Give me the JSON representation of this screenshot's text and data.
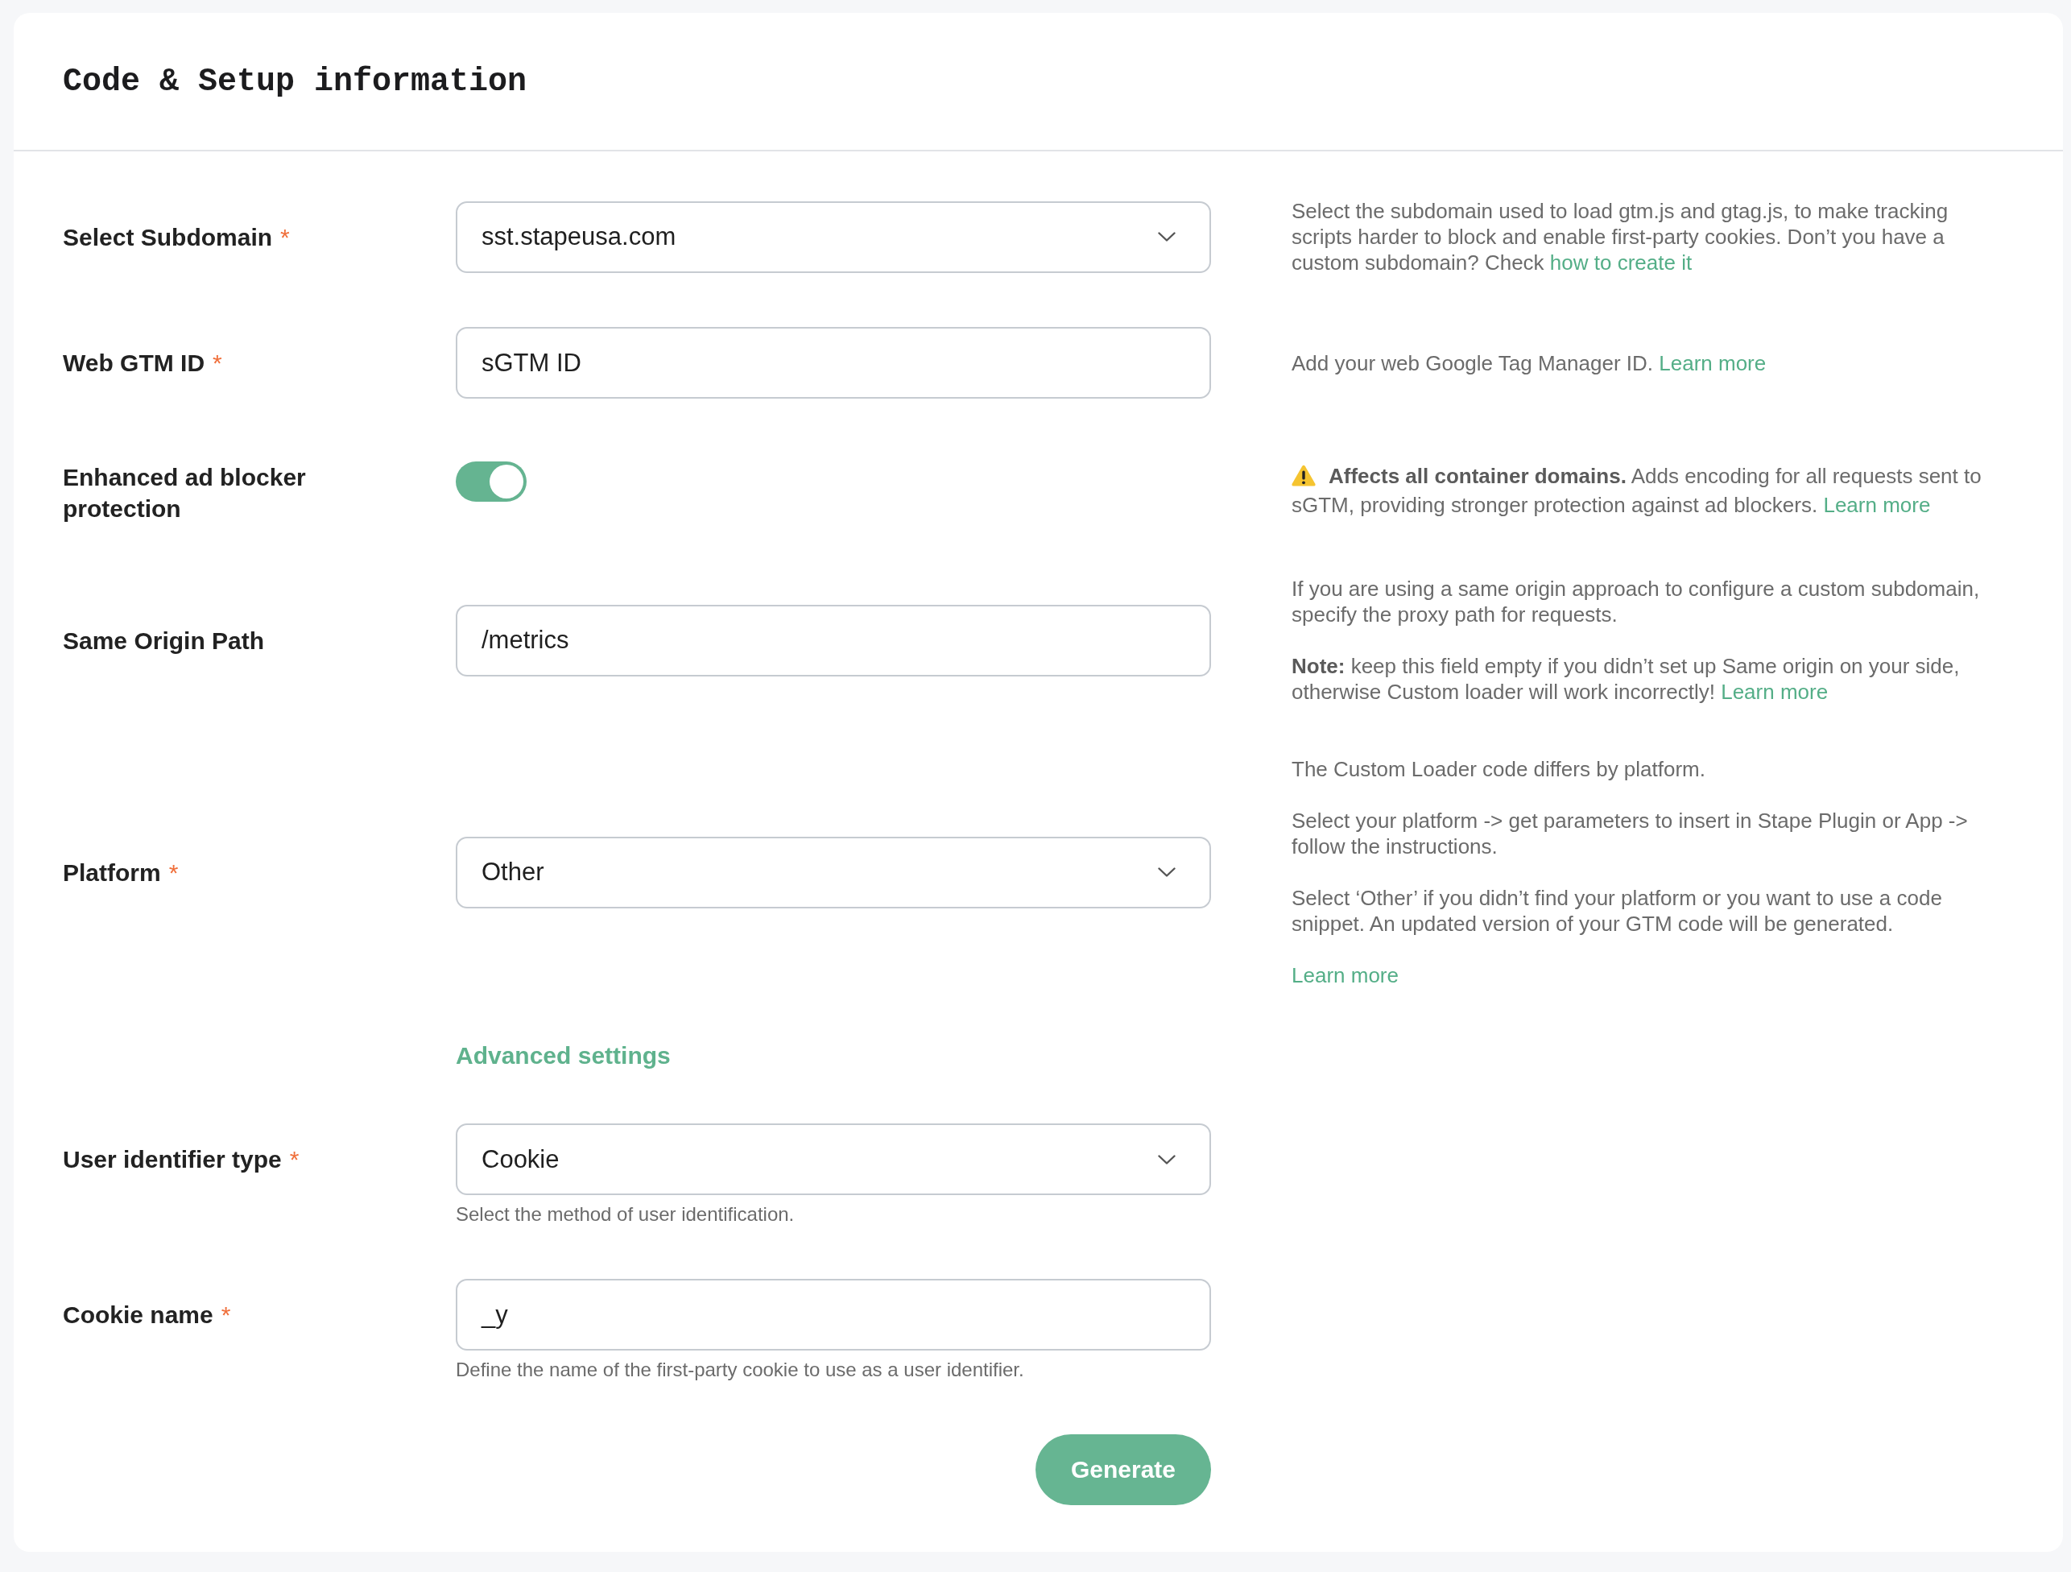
{
  "panel": {
    "title": "Code & Setup information"
  },
  "fields": [
    {
      "kind": "select",
      "label": "Select Subdomain",
      "required_marker": "*",
      "value": "sst.stapeusa.com",
      "help": [
        {
          "kind": "plain",
          "text": "Select the subdomain used to load gtm.js and gtag.js, to make tracking scripts harder to block and enable first-party cookies. Don’t you have a custom subdomain? Check",
          "link": "how to create it"
        }
      ]
    },
    {
      "kind": "text",
      "label": "Web GTM ID",
      "required_marker": "*",
      "value": "sGTM ID",
      "help": [
        {
          "kind": "plain",
          "text": "Add your web Google Tag Manager ID.",
          "link": "Learn more"
        }
      ]
    },
    {
      "kind": "toggle",
      "label": "Enhanced ad blocker protection",
      "on": true,
      "help": [
        {
          "kind": "warning",
          "text": "**Affects all container domains.** Adds encoding for all requests sent to sGTM, providing stronger protection against ad blockers.",
          "link": "Learn more"
        }
      ]
    },
    {
      "kind": "text",
      "label": "Same Origin Path",
      "value": "/metrics",
      "help": [
        {
          "kind": "plain",
          "text": "If you are using a same origin approach to configure a custom subdomain, specify the proxy path for requests."
        },
        {
          "kind": "plain",
          "text": "**Note:** keep this field empty if you didn’t set up Same origin on your side, otherwise Custom loader will work incorrectly!",
          "link": "Learn more"
        }
      ]
    },
    {
      "kind": "select",
      "label": "Platform",
      "required_marker": "*",
      "value": "Other",
      "help": [
        {
          "kind": "plain",
          "text": "The Custom Loader code differs by platform."
        },
        {
          "kind": "plain",
          "text": "Select your platform -> get parameters to insert in Stape Plugin or App -> follow the instructions."
        },
        {
          "kind": "plain",
          "text": "Select ‘Other’ if you didn’t find your platform or you want to use a code snippet. An updated version of your GTM code will be generated."
        },
        {
          "kind": "plain",
          "link": "Learn more"
        }
      ]
    }
  ],
  "advanced_settings": {
    "label": "Advanced settings",
    "fields": [
      {
        "kind": "select",
        "label": "User identifier type",
        "required_marker": "*",
        "value": "Cookie",
        "hint": "Select the method of user identification."
      },
      {
        "kind": "text",
        "label": "Cookie name",
        "required_marker": "*",
        "value": "_y",
        "hint": "Define the name of the first-party cookie to use as a user identifier."
      }
    ]
  },
  "submit_button": {
    "label": "Generate"
  }
}
